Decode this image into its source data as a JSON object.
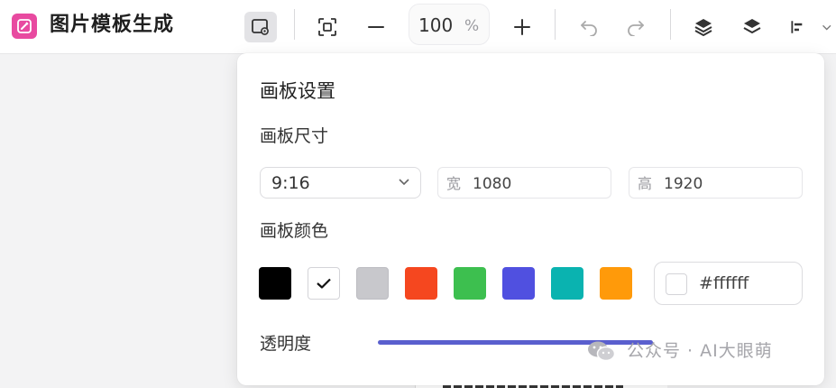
{
  "app": {
    "title": "图片模板生成",
    "accent_color": "#e84aa0",
    "logo_icon": "edit-image-icon"
  },
  "toolbar": {
    "zoom_value": "100",
    "zoom_unit": "%",
    "icons": [
      "board-settings-icon",
      "fit-screen-icon",
      "zoom-out-icon",
      "zoom-in-icon",
      "undo-icon",
      "redo-icon",
      "layer-up-icon",
      "layers-icon",
      "align-left-icon",
      "chevron-down-icon"
    ]
  },
  "board_panel": {
    "title": "画板设置",
    "size_section": "画板尺寸",
    "ratio_value": "9:16",
    "width_label": "宽",
    "width_value": "1080",
    "height_label": "高",
    "height_value": "1920",
    "color_section": "画板颜色",
    "swatches": [
      "#000000",
      "#ffffff",
      "#c8c8cc",
      "#f5471f",
      "#3dbf4f",
      "#5050e0",
      "#0ab3b0",
      "#ff9a0a"
    ],
    "selected_swatch": "#ffffff",
    "hex_value": "#ffffff",
    "opacity_label": "透明度",
    "slider_color": "#5a5fce"
  },
  "watermark": {
    "text": "公众号 · AI大眼萌"
  }
}
